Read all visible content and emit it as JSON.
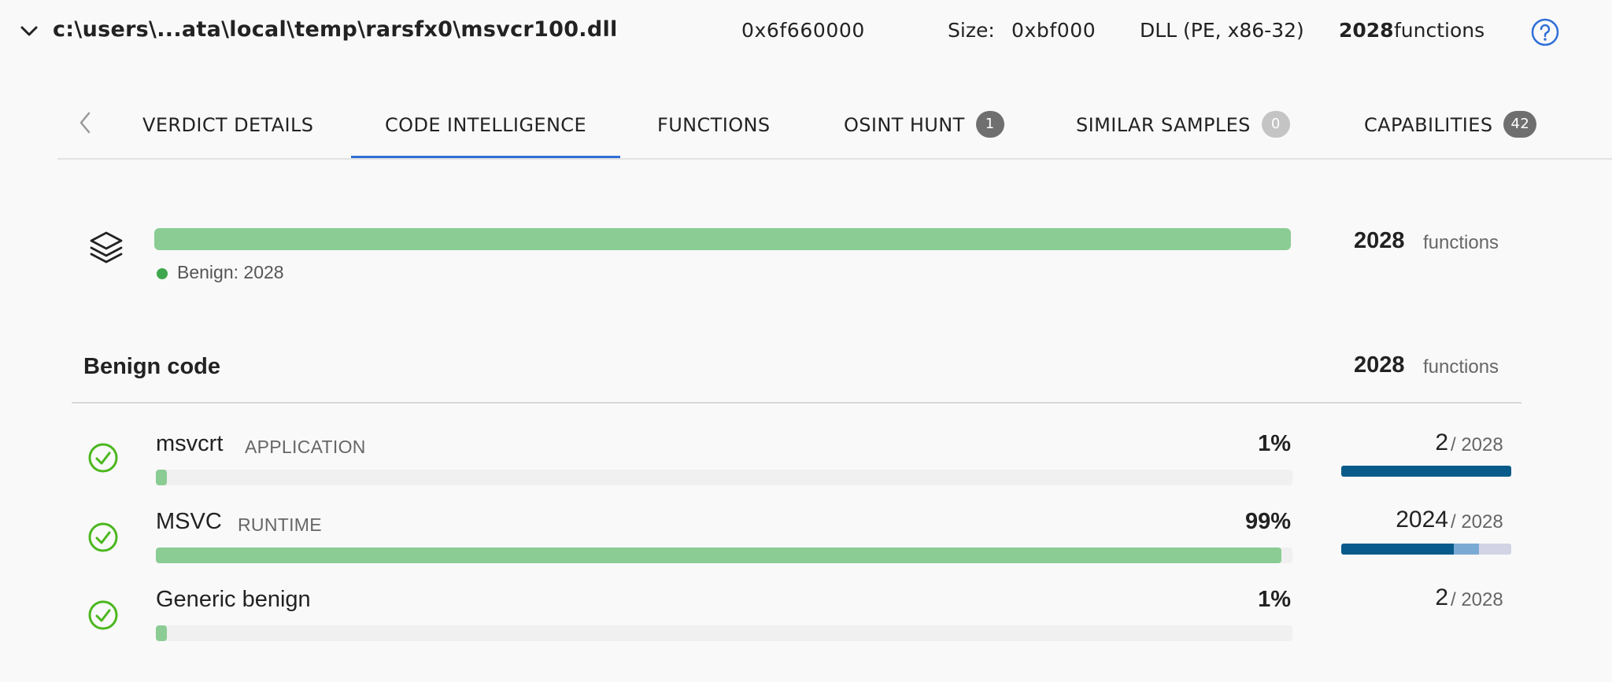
{
  "header": {
    "file_path": "c:\\users\\...ata\\local\\temp\\rarsfx0\\msvcr100.dll",
    "address": "0x6f660000",
    "size_label": "Size:",
    "size_value": "0xbf000",
    "file_type": "DLL (PE, x86-32)",
    "function_count": "2028",
    "function_label": "functions",
    "icons": [
      "chevron-down-icon",
      "help-icon"
    ]
  },
  "tabs": [
    {
      "label": "VERDICT DETAILS",
      "badge": null,
      "active": false
    },
    {
      "label": "CODE INTELLIGENCE",
      "badge": null,
      "active": true
    },
    {
      "label": "FUNCTIONS",
      "badge": null,
      "active": false
    },
    {
      "label": "OSINT HUNT",
      "badge": "1",
      "active": false
    },
    {
      "label": "SIMILAR SAMPLES",
      "badge": "0",
      "active": false
    },
    {
      "label": "CAPABILITIES",
      "badge": "42",
      "active": false
    }
  ],
  "summary": {
    "legend": "Benign: 2028",
    "count": "2028",
    "unit": "functions",
    "benign_fraction": 1.0
  },
  "section": {
    "title": "Benign code",
    "count": "2028",
    "unit": "functions"
  },
  "rows": [
    {
      "name": "msvcrt",
      "tag": "APPLICATION",
      "percent": "1%",
      "fraction": 0.01,
      "count": "2",
      "total": "/ 2028",
      "mini": [
        1.0,
        0.0
      ]
    },
    {
      "name": "MSVC",
      "tag": "RUNTIME",
      "percent": "99%",
      "fraction": 0.99,
      "count": "2024",
      "total": "/ 2028",
      "mini": [
        0.66,
        0.15
      ]
    },
    {
      "name": "Generic benign",
      "tag": "",
      "percent": "1%",
      "fraction": 0.01,
      "count": "2",
      "total": "/ 2028",
      "mini": null
    }
  ],
  "colors": {
    "accent": "#2f6fd8",
    "benign_bar": "#8bcc94",
    "benign_dot": "#3fa84e",
    "check": "#4bb71e",
    "mini_dark": "#075a8a",
    "mini_mid": "#7aaad4",
    "mini_light": "#d3d3e6"
  }
}
